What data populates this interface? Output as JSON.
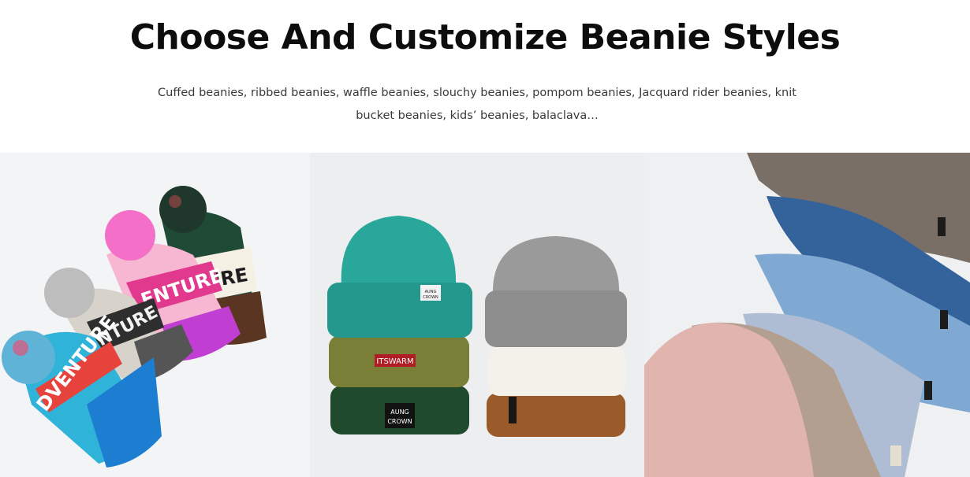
{
  "section": {
    "title": "Choose And Customize Beanie Styles",
    "description": "Cuffed beanies, ribbed beanies, waffle beanies, slouchy beanies, pompom beanies, Jacquard rider beanies, knit bucket beanies, kids’ beanies, balaclava…"
  },
  "gallery": [
    {
      "id": "pompom-beanies",
      "labels": [
        "DVENTURE",
        "ENTURE",
        "NTURE",
        "URE"
      ]
    },
    {
      "id": "cuffed-beanies",
      "labels": [
        "AUNG\nCROWN",
        "ITSWARM",
        "AUNG\nCROWN"
      ]
    },
    {
      "id": "ribbed-beanies"
    }
  ],
  "colors": {
    "title": "#0d0d0d",
    "text": "#3a3a3a",
    "teal": "#2aa79b",
    "olive": "#7a7f37",
    "forest": "#1f4a2c",
    "grey": "#9a9a9a",
    "cream": "#f4f1ea",
    "rust": "#9b5a2a"
  }
}
